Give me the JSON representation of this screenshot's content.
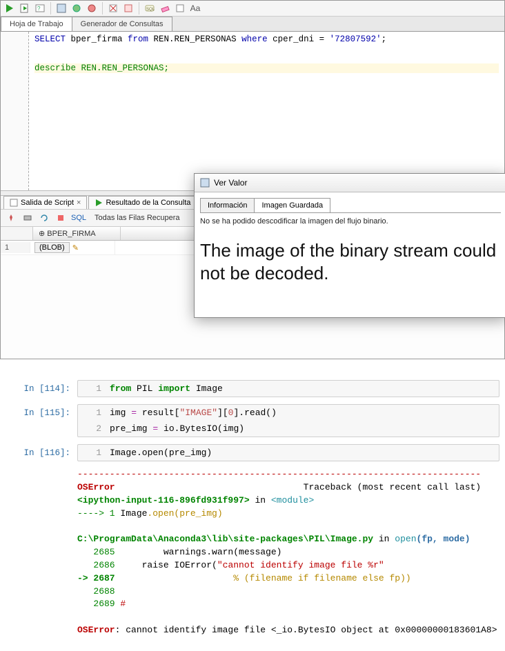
{
  "sql_app": {
    "tabs": {
      "worksheet": "Hoja de Trabajo",
      "query_builder": "Generador de Consultas"
    },
    "editor": {
      "line1_kw1": "SELECT",
      "line1_rest1": " bper_firma ",
      "line1_kw2": "from",
      "line1_rest2": " REN.REN_PERSONAS ",
      "line1_kw3": "where",
      "line1_rest3": " cper_dni = ",
      "line1_str": "'72807592'",
      "line1_end": ";",
      "line3": "describe REN.REN_PERSONAS;"
    },
    "result_tabs": {
      "script_output": "Salida de Script",
      "query_result": "Resultado de la Consulta"
    },
    "result_toolbar": {
      "sql_label": "SQL",
      "all_rows": "Todas las Filas Recupera"
    },
    "grid": {
      "col1": "BPER_FIRMA",
      "row1_num": "1",
      "row1_val": "(BLOB)"
    }
  },
  "dialog": {
    "title": "Ver Valor",
    "tabs": {
      "info": "Información",
      "img": "Imagen Guardada"
    },
    "status": "No se ha podido descodificar la imagen del flujo binario.",
    "big": "The image of the binary stream could not be decoded."
  },
  "jupyter": {
    "cells": [
      {
        "prompt": "In [114]:",
        "lines": [
          {
            "n": "1",
            "html": "<span class='py-kw'>from</span> PIL <span class='py-kw'>import</span> Image"
          }
        ]
      },
      {
        "prompt": "In [115]:",
        "lines": [
          {
            "n": "1",
            "html": "img <span class='py-op'>=</span> result[<span class='py-str'>\"IMAGE\"</span>][<span class='py-str'>0</span>].read()"
          },
          {
            "n": "2",
            "html": "pre_img <span class='py-op'>=</span> io.BytesIO(img)"
          }
        ]
      },
      {
        "prompt": "In [116]:",
        "lines": [
          {
            "n": "1",
            "html": "Image.open(pre_img)"
          }
        ]
      }
    ],
    "traceback": {
      "dashline": "---------------------------------------------------------------------------",
      "err_header_left": "OSError",
      "err_header_right": "Traceback (most recent call last)",
      "l1a": "<ipython-input-116-896fd931f997>",
      "l1b": " in ",
      "l1c": "<module>",
      "l2a": "----> 1",
      "l2b": " Image",
      "l2c": ".open(pre_img)",
      "path": "C:\\ProgramData\\Anaconda3\\lib\\site-packages\\PIL\\Image.py",
      "path_in": " in ",
      "path_fn": "open",
      "path_args": "(fp, mode)",
      "fl_2685_n": "   2685",
      "fl_2685": "         warnings.warn(message)",
      "fl_2686_n": "   2686",
      "fl_2686a": "     raise IOError(",
      "fl_2686b": "\"cannot identify image file %r\"",
      "fl_2687_n": "-> 2687",
      "fl_2687": "                      % (filename if filename else fp))",
      "fl_2688_n": "   2688",
      "fl_2689_n": "   2689",
      "fl_2689": " #",
      "final_err": "OSError",
      "final_msg": ": cannot identify image file <_io.BytesIO object at 0x00000000183601A8>"
    }
  }
}
